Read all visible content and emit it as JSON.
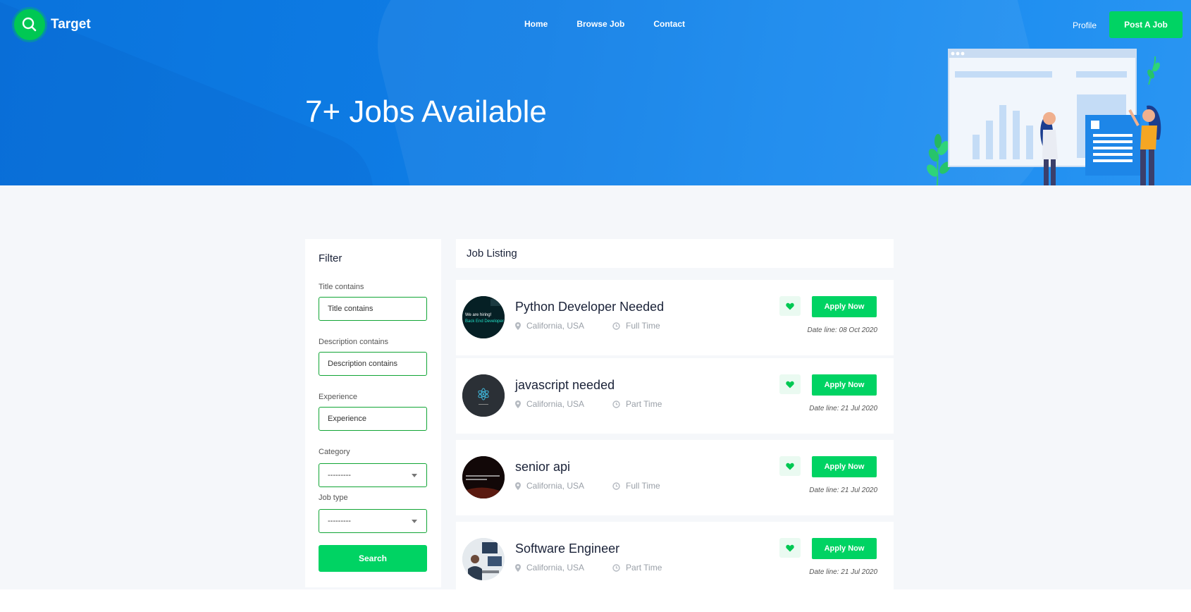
{
  "brand": {
    "name": "Target"
  },
  "nav": {
    "home": "Home",
    "browse_job": "Browse Job",
    "contact": "Contact",
    "profile": "Profile",
    "post_job": "Post A Job"
  },
  "hero": {
    "title": "7+ Jobs Available"
  },
  "filter": {
    "title": "Filter",
    "title_label": "Title contains",
    "title_placeholder": "Title contains",
    "description_label": "Description contains",
    "description_placeholder": "Description contains",
    "experience_label": "Experience",
    "experience_placeholder": "Experience",
    "category_label": "Category",
    "category_value": "---------",
    "jobtype_label": "Job type",
    "jobtype_value": "---------",
    "search_label": "Search"
  },
  "listing": {
    "title": "Job Listing",
    "apply_label": "Apply Now",
    "jobs": [
      {
        "title": "Python Developer Needed",
        "location": "California, USA",
        "type": "Full Time",
        "deadline": "Date line: 08 Oct 2020",
        "thumb_text": "We are hiring! Back End Developer"
      },
      {
        "title": "javascript needed",
        "location": "California, USA",
        "type": "Part Time",
        "deadline": "Date line: 21 Jul 2020"
      },
      {
        "title": "senior api",
        "location": "California, USA",
        "type": "Full Time",
        "deadline": "Date line: 21 Jul 2020"
      },
      {
        "title": "Software Engineer",
        "location": "California, USA",
        "type": "Part Time",
        "deadline": "Date line: 21 Jul 2020"
      }
    ]
  },
  "colors": {
    "hero_blue": "#0f7ee6",
    "accent_green": "#00d363",
    "input_border": "#11a535",
    "page_bg": "#f5f7fa"
  },
  "icons": {
    "logo": "magnifier-icon",
    "favorite": "heart-icon",
    "location": "map-pin-icon",
    "time": "clock-icon",
    "select": "chevron-down-icon"
  }
}
